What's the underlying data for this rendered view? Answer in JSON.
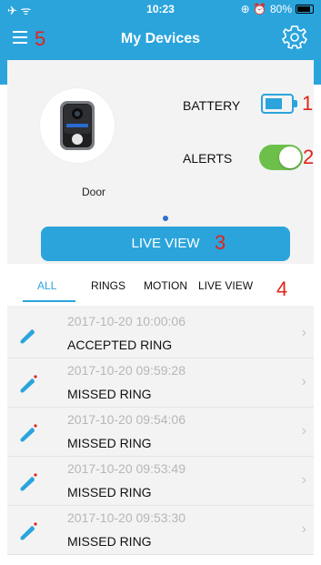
{
  "status_bar": {
    "time": "10:23",
    "battery_pct": "80%"
  },
  "header": {
    "title": "My Devices",
    "menu_number": "5"
  },
  "device": {
    "name": "Door",
    "battery_label": "BATTERY",
    "battery_number": "1",
    "alerts_label": "ALERTS",
    "alerts_number": "2",
    "alerts_on": true,
    "live_view_label": "LIVE VIEW",
    "live_view_number": "3"
  },
  "tabs": {
    "items": [
      "ALL",
      "RINGS",
      "MOTION",
      "LIVE VIEW"
    ],
    "active": "ALL",
    "number": "4"
  },
  "events": [
    {
      "date": "2017-10-20 10:00:06",
      "type": "ACCEPTED RING",
      "missed": false
    },
    {
      "date": "2017-10-20 09:59:28",
      "type": "MISSED RING",
      "missed": true
    },
    {
      "date": "2017-10-20 09:54:06",
      "type": "MISSED RING",
      "missed": true
    },
    {
      "date": "2017-10-20 09:53:49",
      "type": "MISSED RING",
      "missed": true
    },
    {
      "date": "2017-10-20 09:53:30",
      "type": "MISSED RING",
      "missed": true
    }
  ],
  "colors": {
    "accent": "#2ba4dc",
    "toggle_on": "#6cc04a",
    "annotation_red": "#e2231a"
  }
}
